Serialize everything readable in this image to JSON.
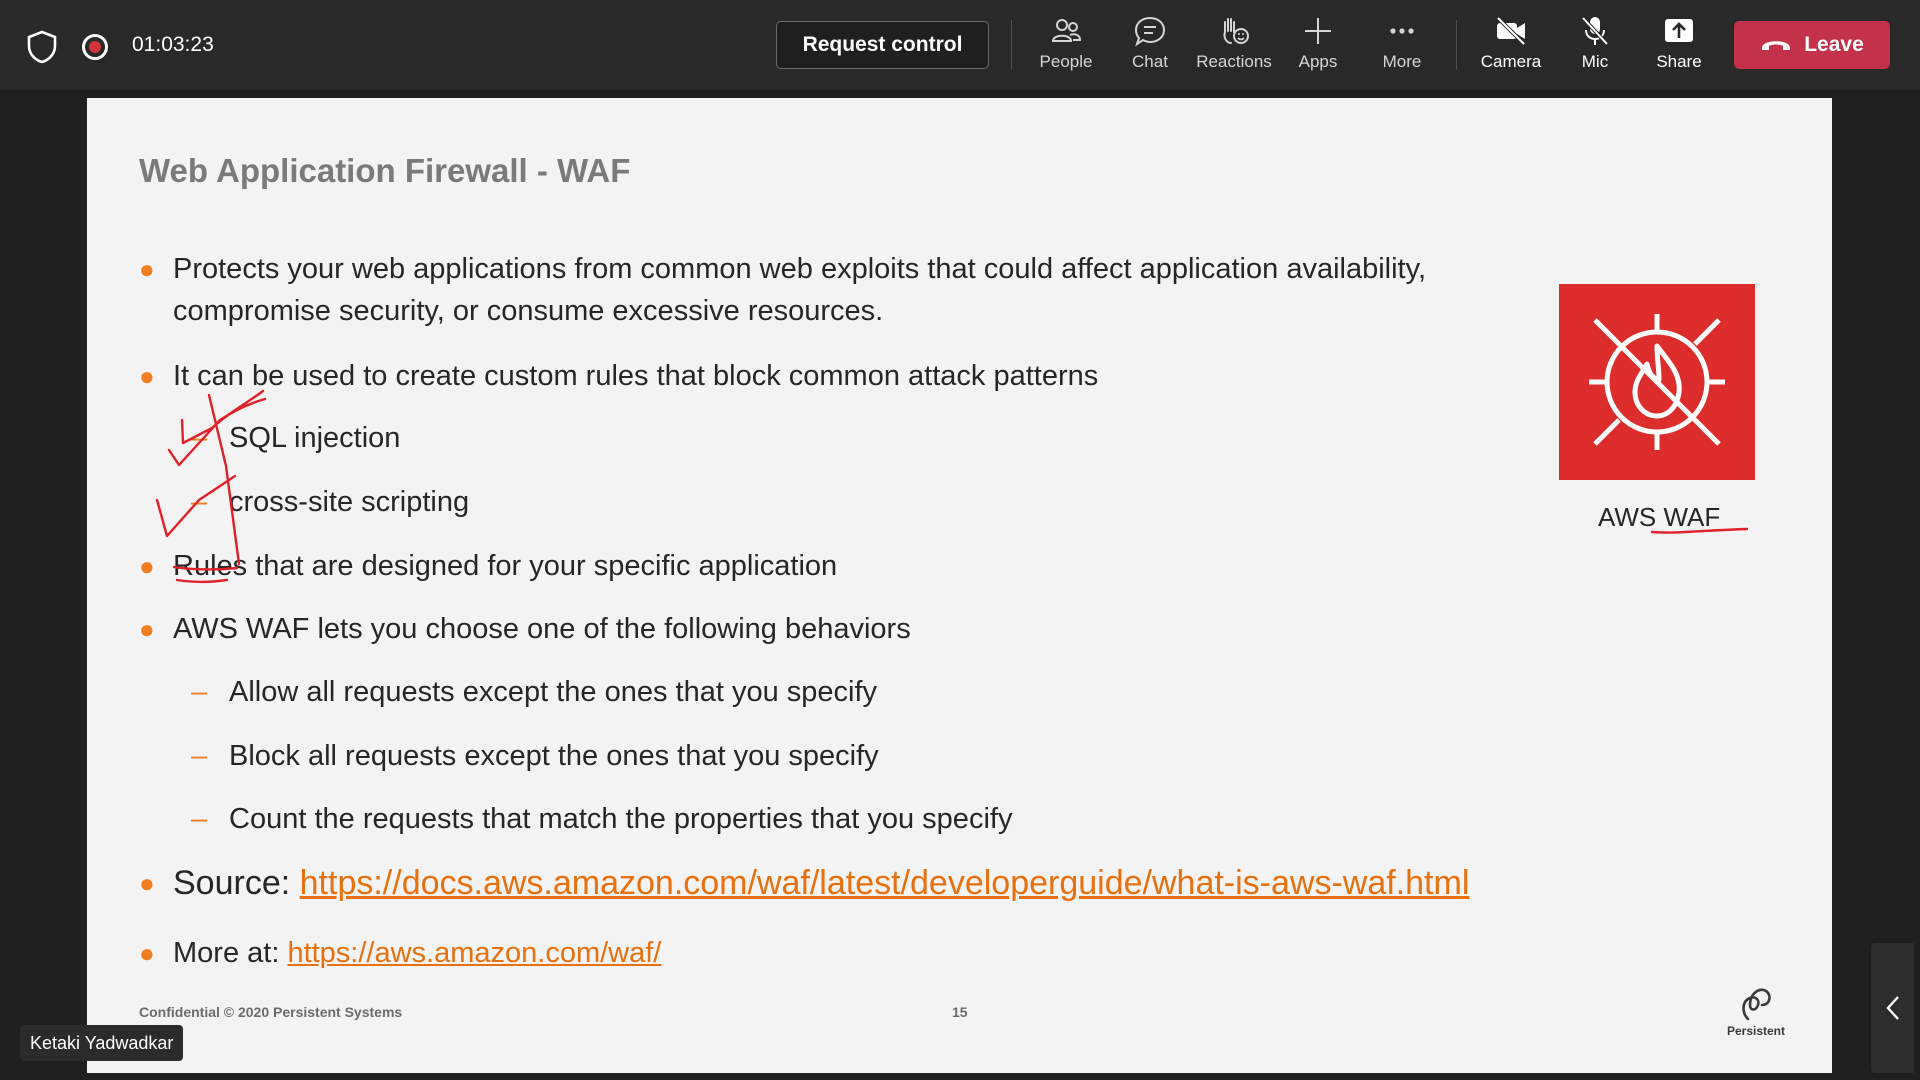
{
  "meeting": {
    "timer": "01:03:23",
    "request_control_label": "Request control",
    "tools": [
      {
        "label": "People",
        "icon": "people-icon"
      },
      {
        "label": "Chat",
        "icon": "chat-icon"
      },
      {
        "label": "Reactions",
        "icon": "reactions-icon"
      },
      {
        "label": "Apps",
        "icon": "plus-icon"
      },
      {
        "label": "More",
        "icon": "more-icon"
      },
      {
        "label": "Camera",
        "icon": "camera-off-icon"
      },
      {
        "label": "Mic",
        "icon": "mic-off-icon"
      },
      {
        "label": "Share",
        "icon": "share-icon"
      }
    ],
    "leave_label": "Leave",
    "leave_color": "#c4314b",
    "participant_name": "Ketaki Yadwadkar"
  },
  "slide": {
    "title": "Web Application Firewall - WAF",
    "bullets": [
      "Protects your web applications from common web exploits that could affect application availability,",
      "compromise security, or consume excessive resources.",
      "It can be used to create custom rules that block common attack patterns",
      "Rules that are designed for your specific application",
      "AWS WAF lets you choose one of the following behaviors"
    ],
    "attack_patterns": [
      "SQL injection",
      "cross-site scripting"
    ],
    "behaviors": [
      "Allow all requests except the ones that you specify",
      "Block all requests except the ones that you specify",
      "Count the requests that match the properties that you specify"
    ],
    "source_label": "Source:",
    "source_url": "https://docs.aws.amazon.com/waf/latest/developerguide/what-is-aws-waf.html",
    "more_label": "More at:",
    "more_url": "https://aws.amazon.com/waf/",
    "product_label": "AWS WAF",
    "footer": "Confidential © 2020 Persistent Systems",
    "page_number": "15",
    "logo_text": "Persistent",
    "accent_color": "#ef7d22",
    "waf_color": "#dd2c2c"
  }
}
